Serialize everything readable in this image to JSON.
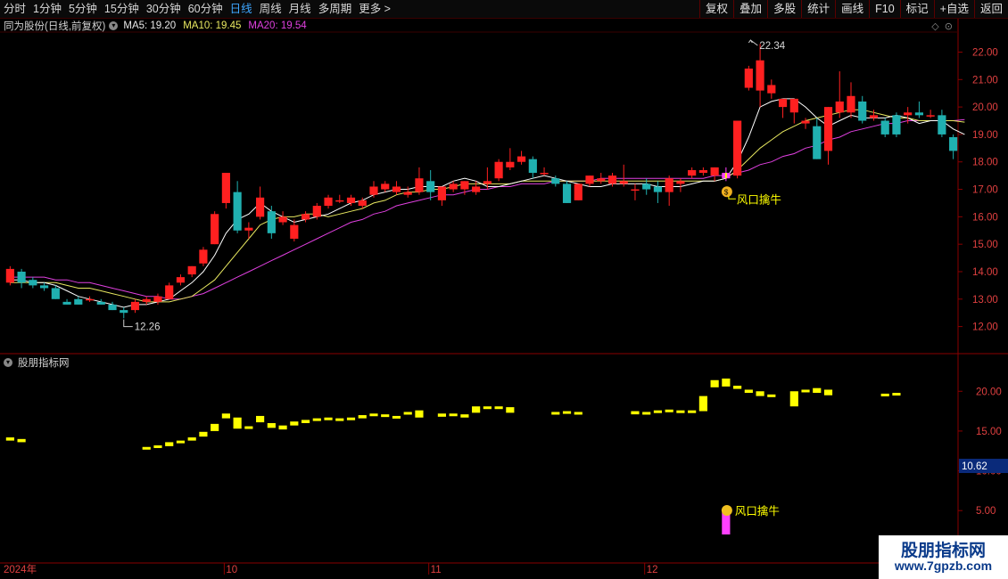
{
  "toolbar": {
    "periods": [
      "分时",
      "1分钟",
      "5分钟",
      "15分钟",
      "30分钟",
      "60分钟",
      "日线",
      "周线",
      "月线",
      "多周期",
      "更多 >"
    ],
    "active_period": "日线",
    "right_buttons": [
      "复权",
      "叠加",
      "多股",
      "统计",
      "画线",
      "F10",
      "标记",
      "+自选",
      "返回"
    ]
  },
  "main_info": {
    "stock_name": "同为股份(日线,前复权)",
    "ma5": "MA5: 19.20",
    "ma10": "MA10: 19.45",
    "ma20": "MA20: 19.54"
  },
  "sub_info": {
    "title": "股朋指标网"
  },
  "main_axis": {
    "ticks": [
      "22.00",
      "21.00",
      "20.00",
      "19.00",
      "18.00",
      "17.00",
      "16.00",
      "15.00",
      "14.00",
      "13.00",
      "12.00"
    ]
  },
  "sub_axis": {
    "ticks": [
      "20.00",
      "15.00",
      "10.00",
      "5.00"
    ],
    "current_value": "10.62"
  },
  "annotations": {
    "high_label": "22.34",
    "low_label": "12.26",
    "signal_label": "风口擒牛",
    "signal_label_sub": "风口擒牛"
  },
  "date_axis": {
    "labels": [
      "2024年",
      "10",
      "11",
      "12"
    ]
  },
  "watermark": {
    "line1": "股朋指标网",
    "line2": "www.7gpzb.com"
  },
  "colors": {
    "up": "#ff2020",
    "down": "#20b0b0",
    "ma5": "#ffffff",
    "ma10": "#e8e860",
    "ma20": "#e040e0",
    "indicator": "#ffff00",
    "signal": "#ff40ff"
  },
  "chart_data": {
    "type": "candlestick",
    "candles": [
      {
        "o": 13.6,
        "h": 14.2,
        "l": 13.5,
        "c": 14.1
      },
      {
        "o": 14.0,
        "h": 14.1,
        "l": 13.4,
        "c": 13.6
      },
      {
        "o": 13.7,
        "h": 13.8,
        "l": 13.4,
        "c": 13.5
      },
      {
        "o": 13.5,
        "h": 13.6,
        "l": 13.3,
        "c": 13.4
      },
      {
        "o": 13.4,
        "h": 13.5,
        "l": 13.0,
        "c": 13.0
      },
      {
        "o": 12.9,
        "h": 13.0,
        "l": 12.8,
        "c": 12.8
      },
      {
        "o": 13.0,
        "h": 13.1,
        "l": 12.8,
        "c": 12.8
      },
      {
        "o": 13.0,
        "h": 13.1,
        "l": 12.9,
        "c": 13.0
      },
      {
        "o": 12.9,
        "h": 13.0,
        "l": 12.8,
        "c": 12.8
      },
      {
        "o": 12.8,
        "h": 12.9,
        "l": 12.6,
        "c": 12.6
      },
      {
        "o": 12.6,
        "h": 12.7,
        "l": 12.3,
        "c": 12.5
      },
      {
        "o": 12.6,
        "h": 13.0,
        "l": 12.5,
        "c": 12.9
      },
      {
        "o": 12.9,
        "h": 13.1,
        "l": 12.8,
        "c": 13.0
      },
      {
        "o": 12.9,
        "h": 13.2,
        "l": 12.8,
        "c": 13.1
      },
      {
        "o": 13.0,
        "h": 13.6,
        "l": 13.0,
        "c": 13.5
      },
      {
        "o": 13.6,
        "h": 13.9,
        "l": 13.5,
        "c": 13.8
      },
      {
        "o": 13.9,
        "h": 14.2,
        "l": 13.8,
        "c": 14.2
      },
      {
        "o": 14.3,
        "h": 14.9,
        "l": 14.2,
        "c": 14.8
      },
      {
        "o": 15.0,
        "h": 16.2,
        "l": 15.0,
        "c": 16.1
      },
      {
        "o": 16.5,
        "h": 17.6,
        "l": 16.3,
        "c": 17.6
      },
      {
        "o": 16.9,
        "h": 17.3,
        "l": 15.4,
        "c": 15.5
      },
      {
        "o": 15.5,
        "h": 15.8,
        "l": 15.2,
        "c": 15.6
      },
      {
        "o": 16.0,
        "h": 17.1,
        "l": 15.9,
        "c": 16.7
      },
      {
        "o": 16.2,
        "h": 16.4,
        "l": 15.2,
        "c": 15.4
      },
      {
        "o": 15.8,
        "h": 16.2,
        "l": 15.7,
        "c": 16.0
      },
      {
        "o": 15.2,
        "h": 15.9,
        "l": 15.1,
        "c": 15.7
      },
      {
        "o": 15.9,
        "h": 16.2,
        "l": 15.8,
        "c": 16.1
      },
      {
        "o": 16.0,
        "h": 16.5,
        "l": 15.9,
        "c": 16.4
      },
      {
        "o": 16.4,
        "h": 16.8,
        "l": 16.3,
        "c": 16.7
      },
      {
        "o": 16.6,
        "h": 16.8,
        "l": 16.5,
        "c": 16.6
      },
      {
        "o": 16.5,
        "h": 16.8,
        "l": 16.4,
        "c": 16.7
      },
      {
        "o": 16.4,
        "h": 16.7,
        "l": 16.3,
        "c": 16.6
      },
      {
        "o": 16.8,
        "h": 17.3,
        "l": 16.7,
        "c": 17.1
      },
      {
        "o": 17.0,
        "h": 17.3,
        "l": 16.9,
        "c": 17.2
      },
      {
        "o": 16.9,
        "h": 17.3,
        "l": 16.8,
        "c": 17.1
      },
      {
        "o": 16.8,
        "h": 17.1,
        "l": 16.7,
        "c": 16.9
      },
      {
        "o": 16.9,
        "h": 17.8,
        "l": 16.8,
        "c": 17.4
      },
      {
        "o": 17.3,
        "h": 17.7,
        "l": 16.6,
        "c": 16.9
      },
      {
        "o": 16.6,
        "h": 17.0,
        "l": 16.4,
        "c": 17.1
      },
      {
        "o": 17.0,
        "h": 17.3,
        "l": 16.9,
        "c": 17.2
      },
      {
        "o": 17.0,
        "h": 17.3,
        "l": 16.8,
        "c": 17.3
      },
      {
        "o": 16.9,
        "h": 17.3,
        "l": 16.8,
        "c": 17.1
      },
      {
        "o": 17.2,
        "h": 17.8,
        "l": 17.0,
        "c": 17.3
      },
      {
        "o": 17.4,
        "h": 18.1,
        "l": 17.3,
        "c": 18.0
      },
      {
        "o": 17.8,
        "h": 18.5,
        "l": 17.7,
        "c": 18.0
      },
      {
        "o": 18.0,
        "h": 18.4,
        "l": 17.9,
        "c": 18.2
      },
      {
        "o": 18.1,
        "h": 18.2,
        "l": 17.4,
        "c": 17.6
      },
      {
        "o": 17.6,
        "h": 17.8,
        "l": 17.5,
        "c": 17.6
      },
      {
        "o": 17.4,
        "h": 17.5,
        "l": 17.1,
        "c": 17.2
      },
      {
        "o": 17.2,
        "h": 17.3,
        "l": 16.5,
        "c": 16.5
      },
      {
        "o": 16.6,
        "h": 17.2,
        "l": 16.6,
        "c": 17.2
      },
      {
        "o": 17.2,
        "h": 17.5,
        "l": 17.1,
        "c": 17.5
      },
      {
        "o": 17.3,
        "h": 17.6,
        "l": 17.2,
        "c": 17.4
      },
      {
        "o": 17.2,
        "h": 17.6,
        "l": 17.1,
        "c": 17.5
      },
      {
        "o": 17.2,
        "h": 17.9,
        "l": 17.1,
        "c": 17.3
      },
      {
        "o": 17.0,
        "h": 17.2,
        "l": 16.6,
        "c": 17.0
      },
      {
        "o": 17.2,
        "h": 17.4,
        "l": 16.8,
        "c": 17.0
      },
      {
        "o": 17.1,
        "h": 17.3,
        "l": 16.5,
        "c": 16.9
      },
      {
        "o": 16.9,
        "h": 17.5,
        "l": 16.4,
        "c": 17.4
      },
      {
        "o": 17.2,
        "h": 17.4,
        "l": 16.9,
        "c": 17.3
      },
      {
        "o": 17.5,
        "h": 17.8,
        "l": 17.4,
        "c": 17.7
      },
      {
        "o": 17.6,
        "h": 17.8,
        "l": 17.5,
        "c": 17.7
      },
      {
        "o": 17.5,
        "h": 17.8,
        "l": 17.3,
        "c": 17.8
      },
      {
        "o": 17.4,
        "h": 17.8,
        "l": 17.3,
        "c": 17.6
      },
      {
        "o": 17.5,
        "h": 19.5,
        "l": 17.4,
        "c": 19.5
      },
      {
        "o": 20.7,
        "h": 21.5,
        "l": 20.6,
        "c": 21.4
      },
      {
        "o": 20.6,
        "h": 22.3,
        "l": 20.0,
        "c": 21.7
      },
      {
        "o": 20.5,
        "h": 21.0,
        "l": 20.3,
        "c": 20.8
      },
      {
        "o": 20.0,
        "h": 20.3,
        "l": 19.6,
        "c": 20.3
      },
      {
        "o": 19.8,
        "h": 20.3,
        "l": 19.4,
        "c": 20.3
      },
      {
        "o": 19.4,
        "h": 19.6,
        "l": 19.2,
        "c": 19.5
      },
      {
        "o": 19.3,
        "h": 19.6,
        "l": 18.1,
        "c": 18.1
      },
      {
        "o": 18.4,
        "h": 20.0,
        "l": 17.9,
        "c": 20.0
      },
      {
        "o": 19.8,
        "h": 21.3,
        "l": 19.6,
        "c": 20.2
      },
      {
        "o": 19.8,
        "h": 20.9,
        "l": 19.6,
        "c": 20.4
      },
      {
        "o": 20.2,
        "h": 20.4,
        "l": 19.4,
        "c": 19.5
      },
      {
        "o": 19.6,
        "h": 19.9,
        "l": 19.5,
        "c": 19.7
      },
      {
        "o": 19.5,
        "h": 19.6,
        "l": 18.9,
        "c": 19.0
      },
      {
        "o": 19.7,
        "h": 19.8,
        "l": 18.9,
        "c": 19.0
      },
      {
        "o": 19.7,
        "h": 20.0,
        "l": 19.4,
        "c": 19.8
      },
      {
        "o": 19.8,
        "h": 20.2,
        "l": 19.6,
        "c": 19.7
      },
      {
        "o": 19.7,
        "h": 19.9,
        "l": 19.6,
        "c": 19.7
      },
      {
        "o": 19.7,
        "h": 19.9,
        "l": 18.9,
        "c": 19.0
      },
      {
        "o": 18.9,
        "h": 19.0,
        "l": 18.1,
        "c": 18.4
      }
    ],
    "ma5": [
      13.7,
      13.7,
      13.6,
      13.6,
      13.5,
      13.3,
      13.1,
      13.0,
      12.9,
      12.8,
      12.7,
      12.8,
      12.8,
      12.9,
      13.0,
      13.3,
      13.6,
      14.0,
      14.6,
      15.4,
      15.9,
      16.1,
      16.5,
      16.2,
      16.0,
      15.8,
      15.9,
      16.0,
      16.1,
      16.3,
      16.5,
      16.6,
      16.8,
      16.9,
      17.0,
      17.0,
      17.1,
      17.1,
      17.1,
      17.3,
      17.4,
      17.3,
      17.1,
      17.1,
      17.2,
      17.3,
      17.4,
      17.5,
      17.4,
      17.3,
      17.2,
      17.1,
      17.1,
      17.2,
      17.2,
      17.2,
      17.2,
      17.1,
      17.1,
      17.1,
      17.2,
      17.3,
      17.3,
      17.4,
      18.0,
      18.9,
      20.0,
      20.2,
      20.3,
      20.3,
      20.0,
      19.6,
      19.3,
      19.5,
      19.7,
      19.6,
      19.6,
      19.6,
      19.7,
      19.6,
      19.4,
      19.5,
      19.5,
      19.2,
      19.0
    ],
    "ma10": [
      13.6,
      13.6,
      13.6,
      13.6,
      13.6,
      13.5,
      13.4,
      13.4,
      13.3,
      13.2,
      13.1,
      13.0,
      12.9,
      12.9,
      12.9,
      13.0,
      13.1,
      13.4,
      13.7,
      14.2,
      14.7,
      15.2,
      15.7,
      15.9,
      16.0,
      16.0,
      16.1,
      16.1,
      16.0,
      16.1,
      16.2,
      16.3,
      16.5,
      16.6,
      16.8,
      16.9,
      16.9,
      17.0,
      17.0,
      17.1,
      17.2,
      17.2,
      17.2,
      17.2,
      17.2,
      17.3,
      17.3,
      17.3,
      17.3,
      17.3,
      17.3,
      17.3,
      17.3,
      17.3,
      17.3,
      17.3,
      17.3,
      17.3,
      17.3,
      17.3,
      17.3,
      17.3,
      17.3,
      17.4,
      17.7,
      18.1,
      18.5,
      18.8,
      19.1,
      19.3,
      19.5,
      19.6,
      19.7,
      19.8,
      19.9,
      19.9,
      19.8,
      19.7,
      19.6,
      19.6,
      19.5,
      19.5,
      19.5,
      19.5,
      19.45
    ],
    "ma20": [
      13.8,
      13.8,
      13.8,
      13.8,
      13.7,
      13.7,
      13.6,
      13.6,
      13.5,
      13.4,
      13.3,
      13.2,
      13.1,
      13.1,
      13.0,
      13.0,
      13.1,
      13.2,
      13.4,
      13.6,
      13.8,
      14.0,
      14.2,
      14.4,
      14.6,
      14.8,
      15.0,
      15.2,
      15.4,
      15.6,
      15.8,
      15.9,
      16.1,
      16.2,
      16.4,
      16.5,
      16.6,
      16.7,
      16.8,
      16.8,
      16.9,
      17.0,
      17.0,
      17.1,
      17.1,
      17.2,
      17.2,
      17.2,
      17.3,
      17.3,
      17.3,
      17.3,
      17.4,
      17.4,
      17.4,
      17.4,
      17.4,
      17.4,
      17.4,
      17.4,
      17.4,
      17.4,
      17.5,
      17.5,
      17.6,
      17.7,
      17.9,
      18.0,
      18.2,
      18.3,
      18.5,
      18.6,
      18.8,
      18.9,
      19.1,
      19.2,
      19.3,
      19.4,
      19.4,
      19.5,
      19.5,
      19.5,
      19.5,
      19.5,
      19.54
    ],
    "indicator_bars": [
      {
        "lo": 13.8,
        "hi": 14.2
      },
      {
        "lo": 13.6,
        "hi": 14.0
      },
      null,
      null,
      null,
      null,
      null,
      null,
      null,
      null,
      null,
      null,
      {
        "lo": 12.8,
        "hi": 13.0
      },
      {
        "lo": 12.9,
        "hi": 13.2
      },
      {
        "lo": 13.1,
        "hi": 13.6
      },
      {
        "lo": 13.5,
        "hi": 13.8
      },
      {
        "lo": 13.8,
        "hi": 14.2
      },
      {
        "lo": 14.3,
        "hi": 14.9
      },
      {
        "lo": 15.0,
        "hi": 15.9
      },
      {
        "lo": 16.6,
        "hi": 17.2
      },
      {
        "lo": 15.3,
        "hi": 16.7
      },
      {
        "lo": 15.4,
        "hi": 15.6
      },
      {
        "lo": 16.1,
        "hi": 16.9
      },
      {
        "lo": 15.4,
        "hi": 16.0
      },
      {
        "lo": 15.2,
        "hi": 15.7
      },
      {
        "lo": 15.7,
        "hi": 16.2
      },
      {
        "lo": 16.0,
        "hi": 16.4
      },
      {
        "lo": 16.3,
        "hi": 16.6
      },
      {
        "lo": 16.4,
        "hi": 16.7
      },
      {
        "lo": 16.5,
        "hi": 16.6
      },
      {
        "lo": 16.4,
        "hi": 16.7
      },
      {
        "lo": 16.6,
        "hi": 17.0
      },
      {
        "lo": 16.9,
        "hi": 17.2
      },
      {
        "lo": 16.9,
        "hi": 17.1
      },
      {
        "lo": 16.7,
        "hi": 16.9
      },
      {
        "lo": 17.1,
        "hi": 17.4
      },
      {
        "lo": 16.7,
        "hi": 17.6
      },
      null,
      {
        "lo": 16.8,
        "hi": 17.2
      },
      {
        "lo": 16.9,
        "hi": 17.2
      },
      {
        "lo": 16.7,
        "hi": 17.1
      },
      {
        "lo": 17.3,
        "hi": 18.1
      },
      {
        "lo": 17.8,
        "hi": 18.1
      },
      {
        "lo": 17.9,
        "hi": 18.1
      },
      {
        "lo": 17.3,
        "hi": 18.0
      },
      null,
      null,
      null,
      {
        "lo": 17.1,
        "hi": 17.4
      },
      {
        "lo": 17.2,
        "hi": 17.5
      },
      {
        "lo": 17.1,
        "hi": 17.4
      },
      null,
      null,
      null,
      null,
      {
        "lo": 17.1,
        "hi": 17.5
      },
      {
        "lo": 17.1,
        "hi": 17.4
      },
      {
        "lo": 17.3,
        "hi": 17.6
      },
      {
        "lo": 17.4,
        "hi": 17.7
      },
      {
        "lo": 17.3,
        "hi": 17.6
      },
      {
        "lo": 17.3,
        "hi": 17.6
      },
      {
        "lo": 17.5,
        "hi": 19.4
      },
      {
        "lo": 20.5,
        "hi": 21.4
      },
      {
        "lo": 20.6,
        "hi": 21.6
      },
      {
        "lo": 20.3,
        "hi": 20.7
      },
      {
        "lo": 19.8,
        "hi": 20.2
      },
      {
        "lo": 19.4,
        "hi": 20.0
      },
      {
        "lo": 19.3,
        "hi": 19.6
      },
      null,
      {
        "lo": 18.1,
        "hi": 20.0
      },
      {
        "lo": 19.9,
        "hi": 20.2
      },
      {
        "lo": 19.8,
        "hi": 20.4
      },
      {
        "lo": 19.5,
        "hi": 20.2
      },
      null,
      null,
      null,
      null,
      {
        "lo": 19.5,
        "hi": 19.7
      },
      {
        "lo": 19.6,
        "hi": 19.8
      },
      null,
      null
    ],
    "signal_index": 63,
    "main_ylim": [
      11.5,
      22.6
    ],
    "sub_ylim": [
      2.0,
      23.5
    ],
    "high_point": {
      "index": 65,
      "value": 22.34
    },
    "low_point": {
      "index": 10,
      "value": 12.26
    }
  }
}
